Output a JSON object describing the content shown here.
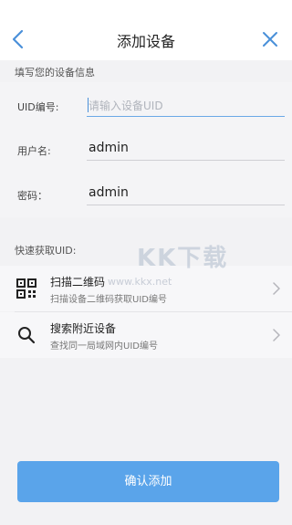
{
  "header": {
    "title": "添加设备",
    "back_icon": "chevron-left-icon",
    "close_icon": "close-icon",
    "accent_color": "#4a90d9"
  },
  "device_info": {
    "section_label": "填写您的设备信息",
    "uid": {
      "label": "UID编号:",
      "value": "",
      "placeholder": "请输入设备UID"
    },
    "username": {
      "label": "用户名:",
      "value": "admin"
    },
    "password": {
      "label": "密码：",
      "value": "admin"
    }
  },
  "quick_uid": {
    "section_label": "快速获取UID:",
    "items": [
      {
        "icon": "qr-code-icon",
        "title": "扫描二维码",
        "subtitle": "扫描设备二维码获取UID编号"
      },
      {
        "icon": "search-icon",
        "title": "搜索附近设备",
        "subtitle": "查找同一局域网内UID编号"
      }
    ]
  },
  "watermark": {
    "text": "KK下载",
    "url": "www.kkx.net"
  },
  "confirm_button": {
    "label": "确认添加",
    "color": "#5aa4ea"
  }
}
